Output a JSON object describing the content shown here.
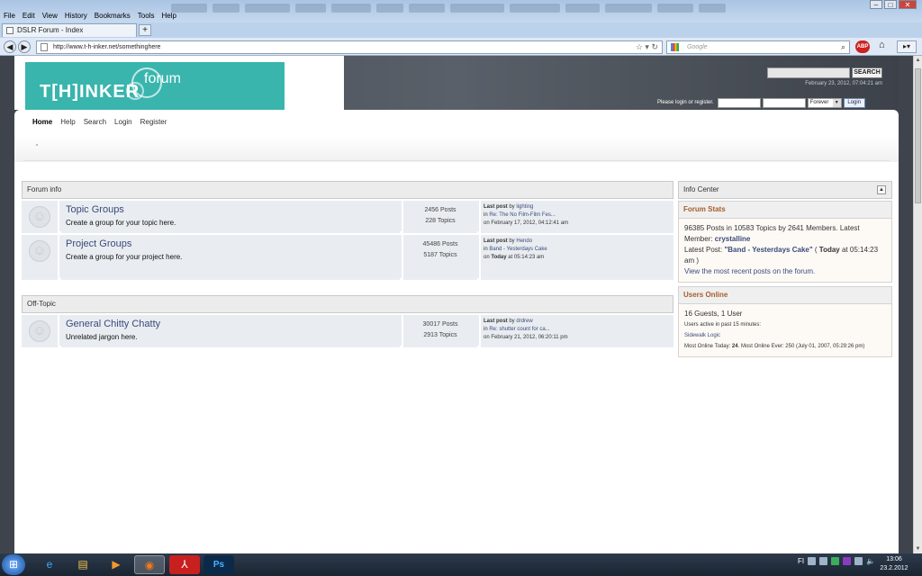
{
  "browser": {
    "menu": [
      "File",
      "Edit",
      "View",
      "History",
      "Bookmarks",
      "Tools",
      "Help"
    ],
    "tab_title": "DSLR Forum - Index",
    "new_tab": "+",
    "url": "http://www.t-h-inker.net/somethinghere",
    "search_placeholder": "Google",
    "adblock": "ABP"
  },
  "header": {
    "logo_text": "T[H]INKER",
    "logo_sub": "forum",
    "search_button": "SEARCH",
    "date": "February 23, 2012, 07:04:21 am",
    "login_prompt": "Please login or register.",
    "duration_value": "Forever",
    "login_button": "Login",
    "brand_color": "#39b5ad"
  },
  "nav": [
    "Home",
    "Help",
    "Search",
    "Login",
    "Register"
  ],
  "categories": [
    {
      "name": "Forum info",
      "boards": [
        {
          "name": "Topic Groups",
          "desc": "Create a group for your topic here.",
          "posts": "2456 Posts",
          "topics": "228 Topics",
          "last_label": "Last post",
          "last_by": "by",
          "last_user": "lighting",
          "last_in": "in",
          "last_topic": "Re: The No Film-Film Fes...",
          "last_when": "on February 17, 2012, 04:12:41 am"
        },
        {
          "name": "Project Groups",
          "desc": "Create a group for your project here.",
          "posts": "45486 Posts",
          "topics": "5187 Topics",
          "last_label": "Last post",
          "last_by": "by",
          "last_user": "Hendo",
          "last_in": "in",
          "last_topic": "Band - Yesterdays Cake",
          "last_when_pre": "on",
          "last_when_bold": "Today",
          "last_when_post": "at 05:14:23 am"
        }
      ]
    },
    {
      "name": "Off-Topic",
      "boards": [
        {
          "name": "General Chitty Chatty",
          "desc": "Unrelated jargon here.",
          "posts": "30017 Posts",
          "topics": "2913 Topics",
          "last_label": "Last post",
          "last_by": "by",
          "last_user": "drdrew",
          "last_in": "in",
          "last_topic": "Re: shutter count for ca...",
          "last_when": "on February 21, 2012, 06:20:11 pm"
        }
      ]
    }
  ],
  "info_center": {
    "title": "Info Center",
    "stats_title": "Forum Stats",
    "stats_line1": "96385 Posts in 10583 Topics by 2641 Members. Latest Member:",
    "latest_member": "crystalline",
    "latest_post_label": "Latest Post:",
    "latest_post_title": "\"Band - Yesterdays Cake\"",
    "latest_post_open": "(",
    "latest_post_today": "Today",
    "latest_post_time": "at 05:14:23 am )",
    "recent_link": "View the most recent posts on the forum.",
    "online_title": "Users Online",
    "online_counts": "16 Guests, 1 User",
    "active_label": "Users active in past 15 minutes:",
    "active_user": "Sidewalk Logic",
    "most_online_pre": "Most Online Today:",
    "most_online_today": "24",
    "most_online_post": ". Most Online Ever: 250 (July 01, 2007, 05:29:26 pm)"
  },
  "taskbar": {
    "apps": [
      "windows-start",
      "internet-explorer",
      "file-explorer",
      "media-player",
      "firefox",
      "adobe-reader",
      "photoshop"
    ],
    "ps_label": "Ps",
    "lang": "FI",
    "time": "13:06",
    "date": "23.2.2012"
  }
}
